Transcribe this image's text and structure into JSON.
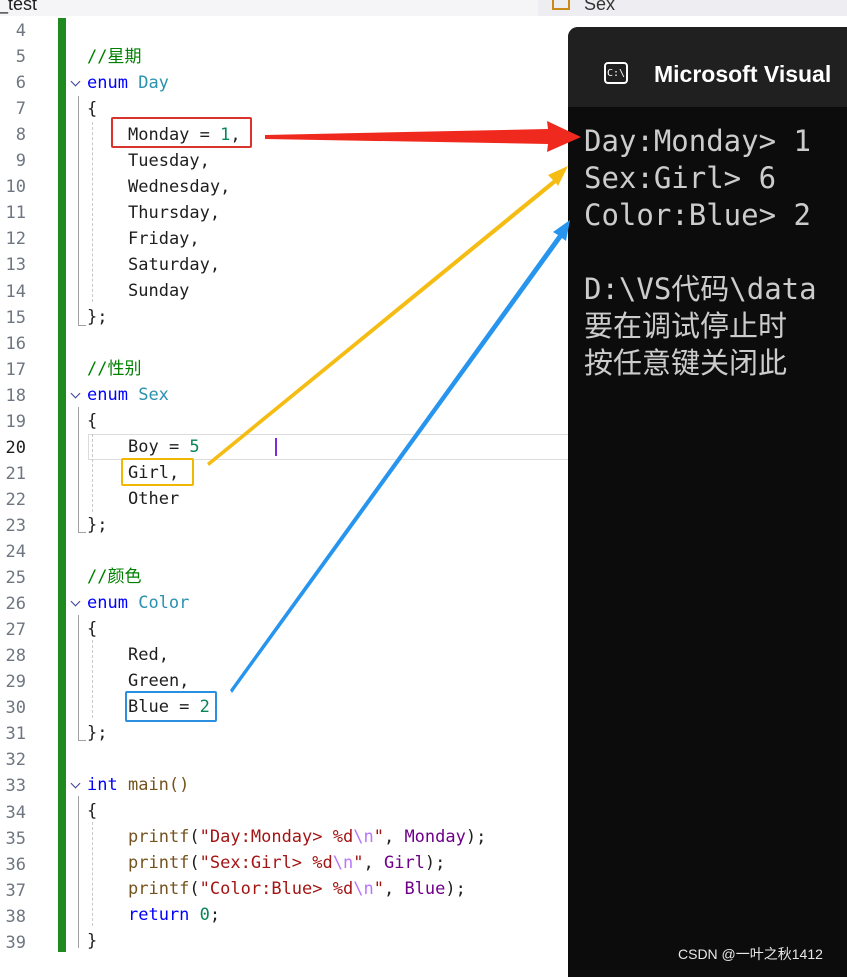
{
  "tabs": {
    "left": "_test",
    "right": "Sex"
  },
  "editor": {
    "current_line": "20",
    "line_numbers": [
      "4",
      "5",
      "6",
      "7",
      "8",
      "9",
      "10",
      "11",
      "12",
      "13",
      "14",
      "15",
      "16",
      "17",
      "18",
      "19",
      "20",
      "21",
      "22",
      "23",
      "24",
      "25",
      "26",
      "27",
      "28",
      "29",
      "30",
      "31",
      "32",
      "33",
      "34",
      "35",
      "36",
      "37",
      "38",
      "39"
    ],
    "comment_day": "//星期",
    "comment_sex": "//性别",
    "comment_color": "//颜色",
    "kw_enum": "enum",
    "kw_int": "int",
    "kw_return": "return",
    "type_day": "Day",
    "type_sex": "Sex",
    "type_color": "Color",
    "brace_open": "{",
    "brace_close_semi": "};",
    "brace_close": "}",
    "day_monday": "Monday = ",
    "day_monday_value": "1",
    "comma": ",",
    "day_members": [
      "Tuesday,",
      "Wednesday,",
      "Thursday,",
      "Friday,",
      "Saturday,",
      "Sunday"
    ],
    "sex_boy": "Boy = ",
    "sex_boy_value": "5",
    "sex_girl": "Girl,",
    "sex_other": "Other",
    "color_red": "Red,",
    "color_green": "Green,",
    "color_blue": "Blue = ",
    "color_blue_value": "2",
    "main_sig": "main()",
    "printf": "printf",
    "printf_lines": [
      {
        "fmt": "Day:Monday> %d",
        "arg": "Monday"
      },
      {
        "fmt": "Sex:Girl> %d",
        "arg": "Girl"
      },
      {
        "fmt": "Color:Blue> %d",
        "arg": "Blue"
      }
    ],
    "escape": "\\n",
    "return_value": "0"
  },
  "console": {
    "icon_label": "C:\\",
    "title": "Microsoft Visual",
    "output": [
      "Day:Monday> 1",
      "Sex:Girl> 6",
      "Color:Blue> 2",
      "",
      "D:\\VS代码\\data",
      "要在调试停止时",
      "按任意键关闭此"
    ]
  },
  "watermark": "CSDN @一叶之秋1412",
  "colors": {
    "arrow_red": "#f0291e",
    "arrow_yellow": "#f5bd14",
    "arrow_blue": "#2795ee",
    "box_red": "#d9342b",
    "box_yellow": "#f0b800",
    "box_blue": "#2a8fe0",
    "gutter_green": "#1f8a1f"
  }
}
